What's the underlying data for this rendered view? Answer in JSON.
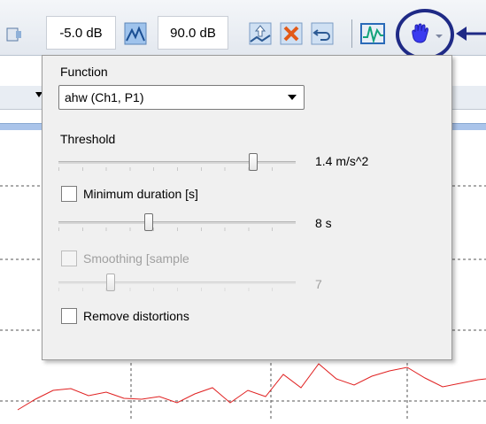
{
  "toolbar": {
    "min_db_value": "-5.0 dB",
    "max_db_value": "90.0 dB"
  },
  "popup": {
    "function_label": "Function",
    "function_selected": "ahw (Ch1, P1)",
    "threshold_label": "Threshold",
    "threshold_value": "1.4 m/s^2",
    "threshold_level": 0.82,
    "min_duration_label": "Minimum duration [s]",
    "min_duration_checked": false,
    "min_duration_value": "8 s",
    "min_duration_level": 0.38,
    "smoothing_label": "Smoothing [sample",
    "smoothing_checked": false,
    "smoothing_enabled": false,
    "smoothing_value": "7",
    "smoothing_level": 0.22,
    "remove_distortions_label": "Remove distortions",
    "remove_distortions_checked": false
  },
  "colors": {
    "highlight_ring": "#1f2a86",
    "signal_line": "#e02020",
    "toolbar_icon_active": "#3b3bf0"
  },
  "icons": [
    "graph-icon",
    "auto-scale-icon",
    "import-icon",
    "delete-icon",
    "undo-icon",
    "waveform-icon",
    "hand-tool-icon"
  ]
}
